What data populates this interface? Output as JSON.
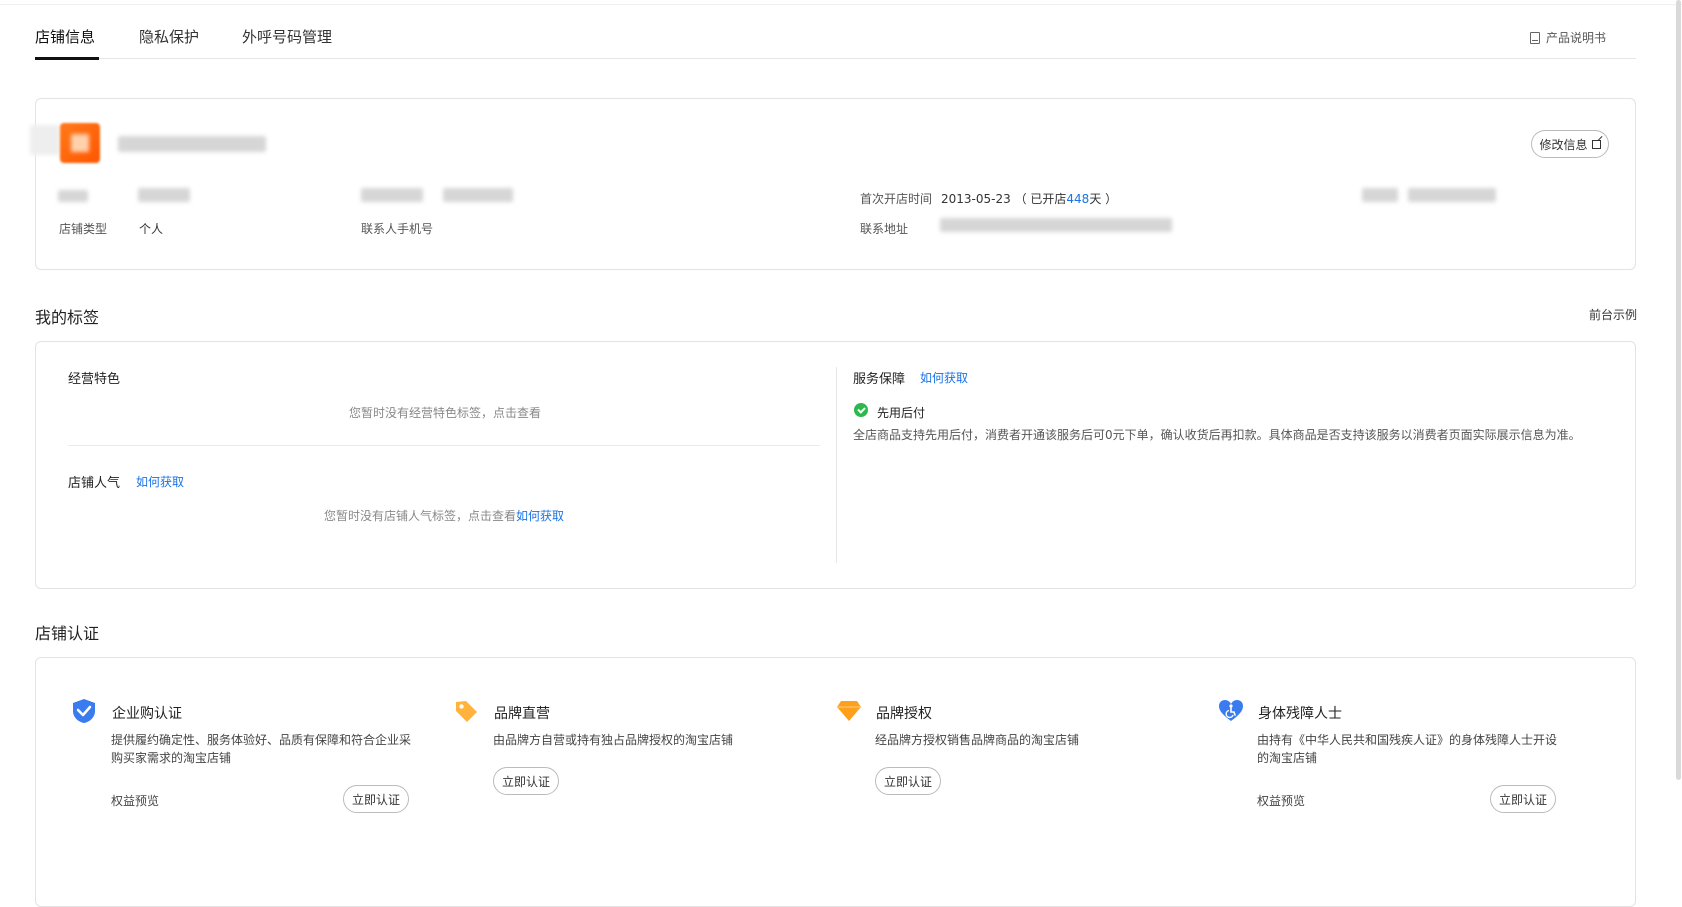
{
  "tabs": [
    {
      "label": "店铺信息",
      "active": true
    },
    {
      "label": "隐私保护",
      "active": false
    },
    {
      "label": "外呼号码管理",
      "active": false
    }
  ],
  "manual": {
    "label": "产品说明书",
    "icon": "book-icon"
  },
  "shop_info": {
    "edit_label": "修改信息",
    "first_open_label": "首次开店时间",
    "first_open_date": "2013-05-23",
    "opened_prefix": "（ 已开店",
    "opened_days": "448",
    "opened_suffix": "天 ）",
    "shop_type_label": "店铺类型",
    "shop_type_value": "个人",
    "contact_phone_label": "联系人手机号",
    "address_label": "联系地址"
  },
  "tags": {
    "title": "我的标签",
    "front_demo": "前台示例",
    "business_feature": {
      "title": "经营特色",
      "empty": "您暂时没有经营特色标签，点击查看"
    },
    "popularity": {
      "title": "店铺人气",
      "how_link": "如何获取",
      "empty_prefix": "您暂时没有店铺人气标签，点击查看",
      "empty_link": "如何获取"
    },
    "service": {
      "title": "服务保障",
      "how_link": "如何获取",
      "item_title": "先用后付",
      "item_desc": "全店商品支持先用后付，消费者开通该服务后可0元下单，确认收货后再扣款。具体商品是否支持该服务以消费者页面实际展示信息为准。"
    }
  },
  "certification": {
    "title": "店铺认证",
    "items": [
      {
        "icon": "shield-check-icon",
        "title": "企业购认证",
        "desc": "提供履约确定性、服务体验好、品质有保障和符合企业采购买家需求的淘宝店铺",
        "preview": "权益预览",
        "button": "立即认证"
      },
      {
        "icon": "tag-icon",
        "title": "品牌直营",
        "desc": "由品牌方自营或持有独占品牌授权的淘宝店铺",
        "button": "立即认证"
      },
      {
        "icon": "diamond-icon",
        "title": "品牌授权",
        "desc": "经品牌方授权销售品牌商品的淘宝店铺",
        "button": "立即认证"
      },
      {
        "icon": "heart-accessibility-icon",
        "title": "身体残障人士",
        "desc": "由持有《中华人民共和国残疾人证》的身体残障人士开设的淘宝店铺",
        "preview": "权益预览",
        "button": "立即认证"
      }
    ]
  },
  "colors": {
    "accent": "#1a73e8",
    "orange": "#ff6a00",
    "green": "#2db84d"
  }
}
